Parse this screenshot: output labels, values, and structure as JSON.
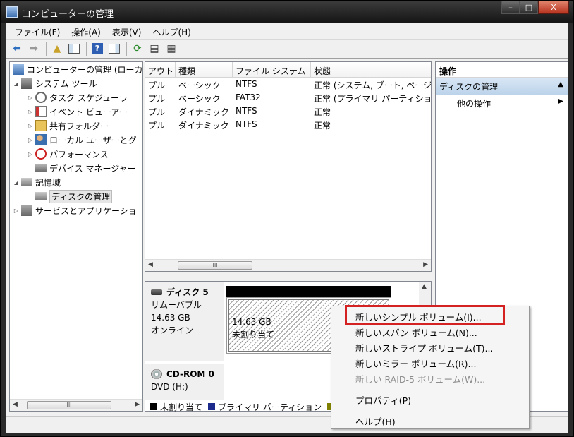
{
  "window": {
    "title": "コンピューターの管理",
    "min": "–",
    "max": "□",
    "close": "X"
  },
  "menu": [
    {
      "label": "ファイル(F)"
    },
    {
      "label": "操作(A)"
    },
    {
      "label": "表示(V)"
    },
    {
      "label": "ヘルプ(H)"
    }
  ],
  "tree": {
    "items": [
      {
        "label": "コンピューターの管理 (ローカ",
        "icon": "computer-management-icon"
      },
      {
        "label": "システム ツール",
        "icon": "system-tools-icon"
      },
      {
        "label": "タスク スケジューラ",
        "icon": "clock-icon"
      },
      {
        "label": "イベント ビューアー",
        "icon": "event-viewer-icon"
      },
      {
        "label": "共有フォルダー",
        "icon": "shared-folder-icon"
      },
      {
        "label": "ローカル ユーザーとグ",
        "icon": "users-icon"
      },
      {
        "label": "パフォーマンス",
        "icon": "performance-icon"
      },
      {
        "label": "デバイス マネージャー",
        "icon": "device-manager-icon"
      },
      {
        "label": "記憶域",
        "icon": "storage-icon"
      },
      {
        "label": "ディスクの管理",
        "icon": "disk-management-icon"
      },
      {
        "label": "サービスとアプリケーショ",
        "icon": "services-icon"
      }
    ],
    "scroll_thumb": "III"
  },
  "volume_list": {
    "columns": [
      "アウト",
      "種類",
      "ファイル システム",
      "状態"
    ],
    "rows": [
      [
        "プル",
        "ベーシック",
        "NTFS",
        "正常 (システム, ブート, ページ"
      ],
      [
        "プル",
        "ベーシック",
        "FAT32",
        "正常 (プライマリ パーティション"
      ],
      [
        "プル",
        "ダイナミック",
        "NTFS",
        "正常"
      ],
      [
        "プル",
        "ダイナミック",
        "NTFS",
        "正常"
      ]
    ],
    "scroll_thumb": "III"
  },
  "disks": [
    {
      "name": "ディスク 5",
      "type": "リムーバブル",
      "size": "14.63 GB",
      "status": "オンライン",
      "volume": {
        "size": "14.63 GB",
        "label": "未割り当て"
      }
    },
    {
      "name": "CD-ROM 0",
      "type": "DVD (H:)"
    }
  ],
  "legend": [
    {
      "label": "未割り当て",
      "color": "#000000"
    },
    {
      "label": "プライマリ パーティション",
      "color": "#1c2a8c"
    },
    {
      "label": "",
      "color": "#808000"
    }
  ],
  "actions": {
    "header": "操作",
    "section": "ディスクの管理",
    "section_arrow": "▲",
    "more": "他の操作",
    "more_arrow": "▶"
  },
  "context_menu": {
    "items": [
      {
        "label": "新しいシンプル ボリューム(I)...",
        "disabled": false
      },
      {
        "label": "新しいスパン ボリューム(N)...",
        "disabled": false
      },
      {
        "label": "新しいストライプ ボリューム(T)...",
        "disabled": false
      },
      {
        "label": "新しいミラー ボリューム(R)...",
        "disabled": false
      },
      {
        "label": "新しい RAID-5 ボリューム(W)...",
        "disabled": true
      },
      {
        "label": "プロパティ(P)",
        "disabled": false
      },
      {
        "label": "ヘルプ(H)",
        "disabled": false
      }
    ]
  },
  "colors": {
    "highlight_box": "#d42121",
    "action_section": "#bcd3ea"
  }
}
